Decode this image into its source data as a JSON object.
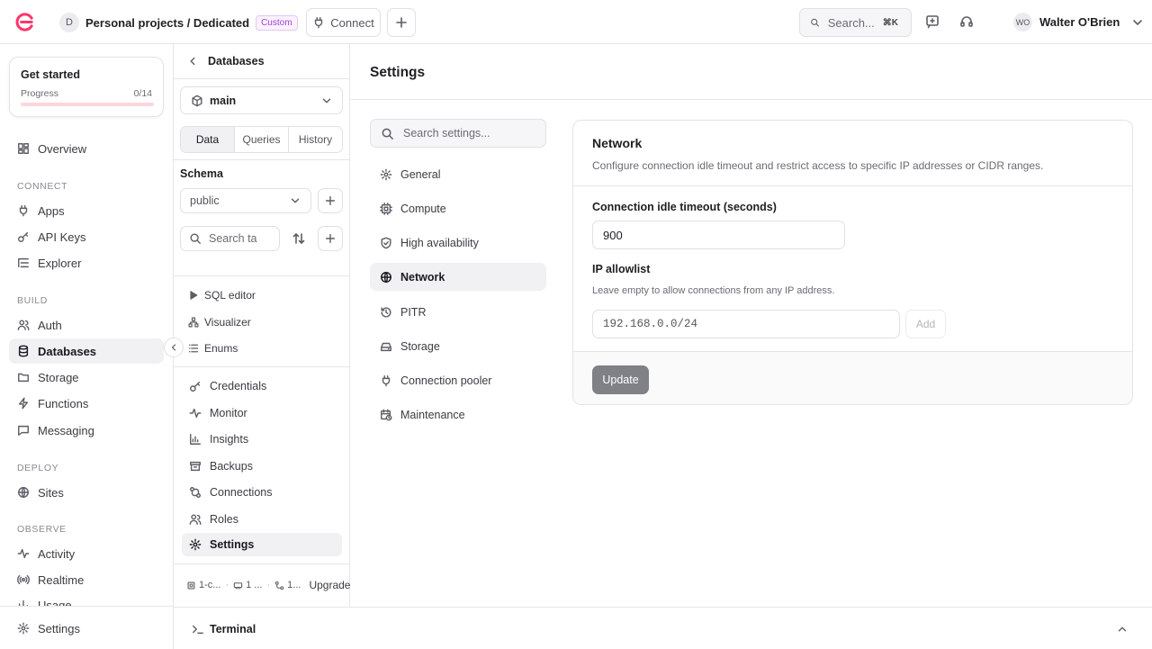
{
  "topbar": {
    "org_initial": "D",
    "project": "Personal projects / Dedicated",
    "plan_badge": "Custom",
    "connect_label": "Connect",
    "search_placeholder": "Search...",
    "search_shortcut": "⌘K",
    "user_initials": "WO",
    "user_name": "Walter O'Brien"
  },
  "get_started": {
    "title": "Get started",
    "progress_label": "Progress",
    "progress_value": "0/14",
    "progress_fraction": 0
  },
  "sidebar": {
    "overview": "Overview",
    "section_connect": "CONNECT",
    "apps": "Apps",
    "api_keys": "API Keys",
    "explorer": "Explorer",
    "section_build": "BUILD",
    "auth": "Auth",
    "databases": "Databases",
    "storage": "Storage",
    "functions": "Functions",
    "messaging": "Messaging",
    "section_deploy": "DEPLOY",
    "sites": "Sites",
    "section_observe": "OBSERVE",
    "activity": "Activity",
    "realtime": "Realtime",
    "usage": "Usage",
    "settings": "Settings"
  },
  "db_panel": {
    "title": "Databases",
    "database": "main",
    "tabs": [
      "Data",
      "Queries",
      "History"
    ],
    "schema_label": "Schema",
    "schema_value": "public",
    "table_search_placeholder": "Search ta",
    "tools": [
      "SQL editor",
      "Visualizer",
      "Enums"
    ],
    "nav": [
      "Credentials",
      "Monitor",
      "Insights",
      "Backups",
      "Connections",
      "Roles",
      "Settings"
    ],
    "footer": {
      "cpu": "1-c...",
      "mem": "1 ...",
      "conn": "1...",
      "upgrade": "Upgrade"
    }
  },
  "main": {
    "title": "Settings",
    "search_placeholder": "Search settings...",
    "nav": [
      "General",
      "Compute",
      "High availability",
      "Network",
      "PITR",
      "Storage",
      "Connection pooler",
      "Maintenance"
    ],
    "network": {
      "title": "Network",
      "description": "Configure connection idle timeout and restrict access to specific IP addresses or CIDR ranges.",
      "timeout_label": "Connection idle timeout (seconds)",
      "timeout_value": "900",
      "allowlist_label": "IP allowlist",
      "allowlist_help": "Leave empty to allow connections from any IP address.",
      "ip_placeholder": "192.168.0.0/24",
      "add_label": "Add",
      "update_label": "Update"
    }
  },
  "terminal": {
    "label": "Terminal"
  },
  "colors": {
    "brand": "#fd366e",
    "custom_badge": "#a53fd6",
    "update_button": "#808087"
  }
}
